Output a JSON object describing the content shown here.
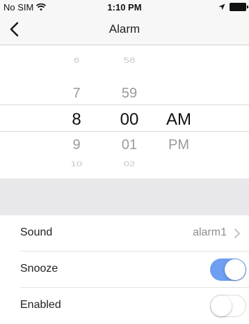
{
  "status_bar": {
    "carrier": "No SIM",
    "time": "1:10 PM",
    "icons": [
      "wifi-icon",
      "location-arrow-icon",
      "battery-icon"
    ]
  },
  "nav": {
    "title": "Alarm",
    "back_icon": "chevron-left-icon"
  },
  "picker": {
    "hours": [
      "6",
      "7",
      "8",
      "9",
      "10"
    ],
    "minutes": [
      "58",
      "59",
      "00",
      "01",
      "02"
    ],
    "ampm": [
      "AM",
      "PM"
    ],
    "selected": {
      "hour": "8",
      "minute": "00",
      "ampm": "AM"
    }
  },
  "settings": {
    "sound": {
      "label": "Sound",
      "value": "alarm1"
    },
    "snooze": {
      "label": "Snooze",
      "on": true
    },
    "enabled": {
      "label": "Enabled",
      "on": false
    }
  },
  "colors": {
    "toggle_on": "#6e9ff0",
    "bar_bg": "#f7f7f7",
    "section_gap": "#e8e8ea"
  }
}
